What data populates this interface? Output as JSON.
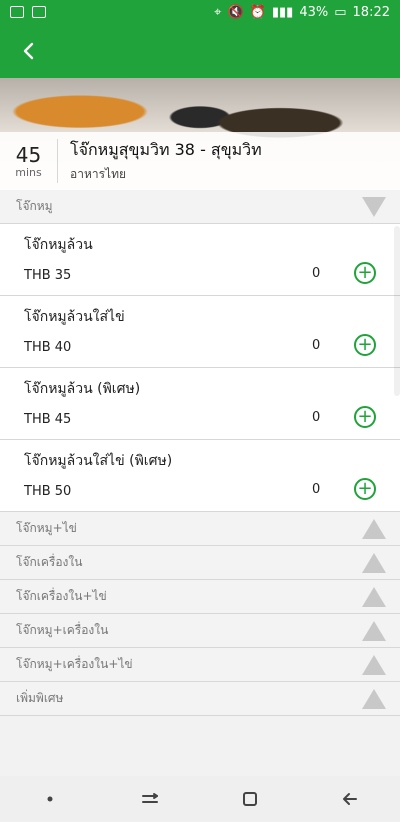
{
  "statusbar": {
    "battery": "43%",
    "time": "18:22"
  },
  "restaurant": {
    "eta_number": "45",
    "eta_unit": "mins",
    "name": "โจ๊กหมูสุขุมวิท 38 - สุขุมวิท",
    "cuisine": "อาหารไทย"
  },
  "menu": {
    "expanded_category": "โจ๊กหมู",
    "items": [
      {
        "title": "โจ๊กหมูล้วน",
        "price": "THB 35",
        "qty": "0"
      },
      {
        "title": "โจ๊กหมูล้วนใส่ไข่",
        "price": "THB 40",
        "qty": "0"
      },
      {
        "title": "โจ๊กหมูล้วน (พิเศษ)",
        "price": "THB 45",
        "qty": "0"
      },
      {
        "title": "โจ๊กหมูล้วนใส่ไข่ (พิเศษ)",
        "price": "THB 50",
        "qty": "0"
      }
    ],
    "collapsed_categories": [
      "โจ๊กหมู+ไข่",
      "โจ๊กเครื่องใน",
      "โจ๊กเครื่องใน+ไข่",
      "โจ๊กหมู+เครื่องใน",
      "โจ๊กหมู+เครื่องใน+ไข่",
      "เพิ่มพิเศษ"
    ]
  },
  "colors": {
    "primary": "#1fa33a"
  },
  "icons": {
    "back": "back-arrow-icon",
    "add": "plus-circle-icon"
  }
}
